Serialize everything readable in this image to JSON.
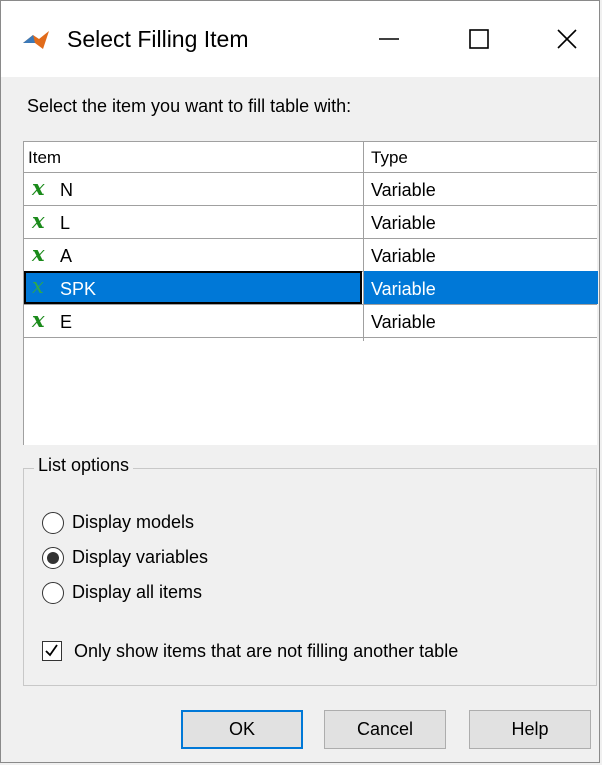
{
  "window": {
    "title": "Select Filling Item",
    "app_icon": "matlab-icon",
    "controls": [
      "minimize-icon",
      "maximize-icon",
      "close-icon"
    ]
  },
  "instruction": "Select the item you want to fill table with:",
  "list": {
    "columns": [
      "Item",
      "Type"
    ],
    "rows": [
      {
        "icon": "variable-x-icon",
        "name": "N",
        "type": "Variable",
        "selected": false
      },
      {
        "icon": "variable-x-icon",
        "name": "L",
        "type": "Variable",
        "selected": false
      },
      {
        "icon": "variable-x-icon",
        "name": "A",
        "type": "Variable",
        "selected": false
      },
      {
        "icon": "variable-x-icon",
        "name": "SPK",
        "type": "Variable",
        "selected": true
      },
      {
        "icon": "variable-x-icon",
        "name": "E",
        "type": "Variable",
        "selected": false
      }
    ],
    "icon_glyph": "x"
  },
  "list_options": {
    "legend": "List options",
    "radios": [
      {
        "label": "Display models",
        "checked": false
      },
      {
        "label": "Display variables",
        "checked": true
      },
      {
        "label": "Display all items",
        "checked": false
      }
    ],
    "checkbox": {
      "label": "Only show items that are not filling another table",
      "checked": true
    }
  },
  "buttons": {
    "ok": "OK",
    "cancel": "Cancel",
    "help": "Help"
  },
  "colors": {
    "selection": "#0078d7",
    "variable_icon": "#1a8a1a",
    "default_button_border": "#0078d7"
  }
}
